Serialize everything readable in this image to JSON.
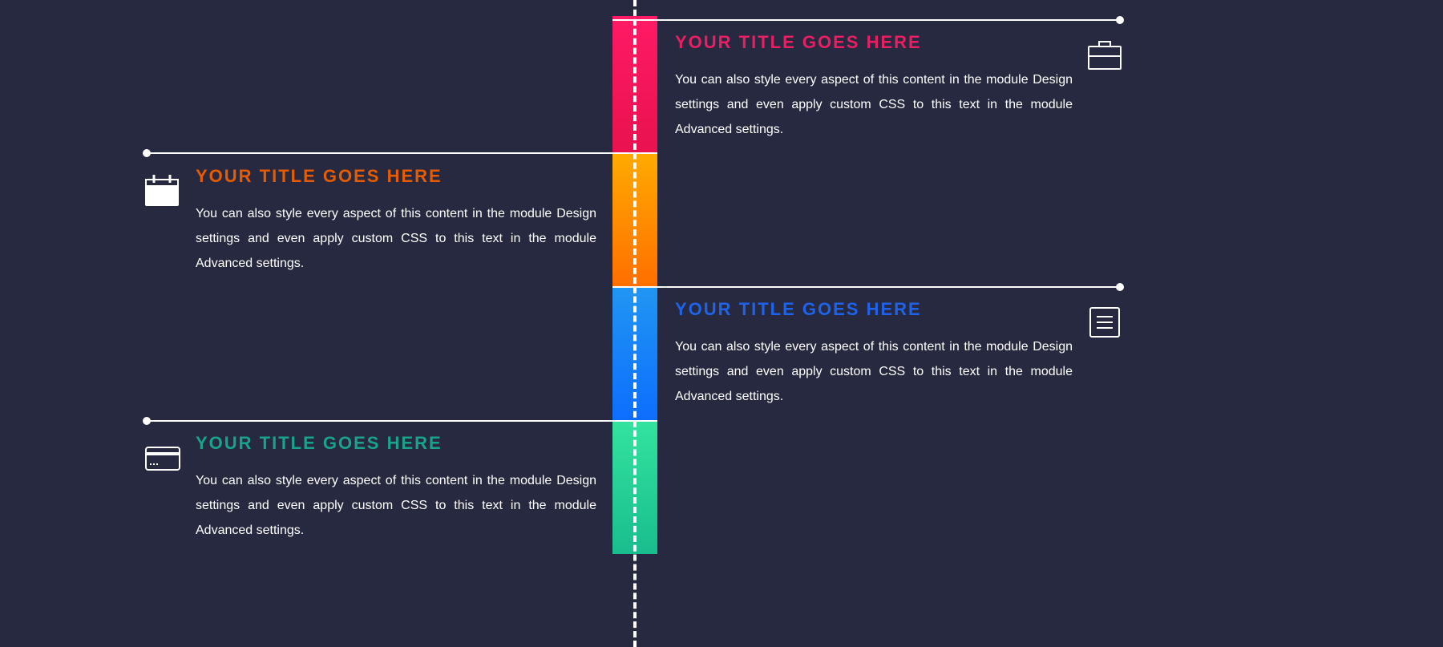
{
  "items": [
    {
      "title": "YOUR TITLE GOES HERE",
      "desc": "You can also style every aspect of this content in the module Design settings and even apply custom CSS to this text in the module Advanced settings.",
      "color": "#e91e63",
      "icon": "briefcase-icon",
      "side": "right"
    },
    {
      "title": "YOUR TITLE GOES HERE",
      "desc": "You can also style every aspect of this content in the module Design settings and even apply custom CSS to this text in the module Advanced settings.",
      "color": "#e65c00",
      "icon": "calendar-icon",
      "side": "left"
    },
    {
      "title": "YOUR TITLE GOES HERE",
      "desc": "You can also style every aspect of this content in the module Design settings and even apply custom CSS to this text in the module Advanced settings.",
      "color": "#1e63e9",
      "icon": "menu-icon",
      "side": "right"
    },
    {
      "title": "YOUR TITLE GOES HERE",
      "desc": "You can also style every aspect of this content in the module Design settings and even apply custom CSS to this text in the module Advanced settings.",
      "color": "#19a38c",
      "icon": "card-icon",
      "side": "left"
    }
  ]
}
